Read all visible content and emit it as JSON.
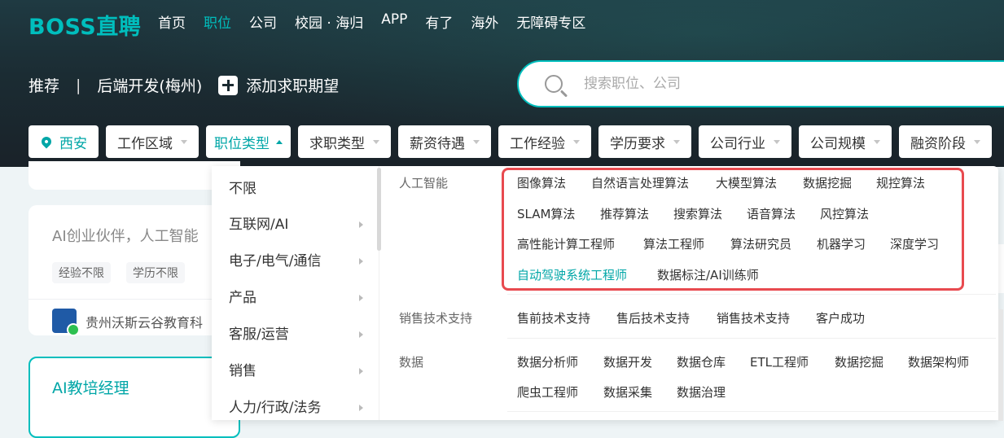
{
  "logo": "BOSS直聘",
  "nav": [
    "首页",
    "职位",
    "公司",
    "校园 · 海归",
    "APP",
    "有了",
    "海外",
    "无障碍专区"
  ],
  "nav_active_index": 1,
  "expectation": {
    "recommend": "推荐",
    "separator": "|",
    "current": "后端开发(梅州)",
    "add_label": "添加求职期望"
  },
  "search": {
    "placeholder": "搜索职位、公司"
  },
  "filters": {
    "city": "西安",
    "items": [
      "工作区域",
      "职位类型",
      "求职类型",
      "薪资待遇",
      "工作经验",
      "学历要求",
      "公司行业",
      "公司规模",
      "融资阶段"
    ]
  },
  "cards": {
    "card2_title": "AI创业伙伴，人工智能",
    "card2_tags": [
      "经验不限",
      "学历不限"
    ],
    "card2_company": "贵州沃斯云谷教育科",
    "card3_title": "AI教培经理"
  },
  "dropdown": {
    "level1": [
      "不限",
      "互联网/AI",
      "电子/电气/通信",
      "产品",
      "客服/运营",
      "销售",
      "人力/行政/法务"
    ],
    "categories": [
      {
        "name": "人工智能",
        "rows": [
          [
            "图像算法",
            "自然语言处理算法",
            "大模型算法",
            "数据挖掘",
            "规控算法"
          ],
          [
            "SLAM算法",
            "推荐算法",
            "搜索算法",
            "语音算法",
            "风控算法"
          ],
          [
            "高性能计算工程师",
            "算法工程师",
            "算法研究员",
            "机器学习",
            "深度学习"
          ],
          [
            "自动驾驶系统工程师",
            "数据标注/AI训练师"
          ]
        ]
      },
      {
        "name": "销售技术支持",
        "rows": [
          [
            "售前技术支持",
            "售后技术支持",
            "销售技术支持",
            "客户成功"
          ]
        ]
      },
      {
        "name": "数据",
        "rows": [
          [
            "数据分析师",
            "数据开发",
            "数据仓库",
            "ETL工程师",
            "数据挖掘",
            "数据架构师"
          ],
          [
            "爬虫工程师",
            "数据采集",
            "数据治理"
          ]
        ]
      }
    ],
    "highlighted": "自动驾驶系统工程师"
  },
  "colors": {
    "accent": "#00bebd",
    "highlight_box": "#e84a4f"
  }
}
